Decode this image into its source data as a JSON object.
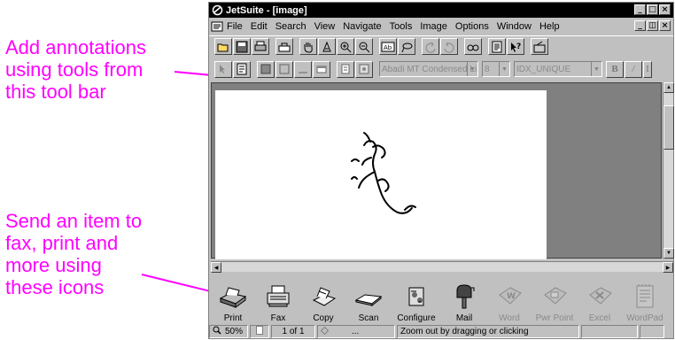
{
  "callouts": {
    "toolbar_note": [
      "Add annotations",
      "using tools from",
      "this tool bar"
    ],
    "icons_note": [
      "Send an item to",
      "fax, print and",
      "more using",
      "these icons"
    ]
  },
  "window": {
    "title": "JetSuite - [image]",
    "menu": [
      {
        "label": "File"
      },
      {
        "label": "Edit"
      },
      {
        "label": "Search"
      },
      {
        "label": "View"
      },
      {
        "label": "Navigate"
      },
      {
        "label": "Tools"
      },
      {
        "label": "Image"
      },
      {
        "label": "Options"
      },
      {
        "label": "Window"
      },
      {
        "label": "Help"
      }
    ]
  },
  "annotation_toolbar": {
    "font_name": "Abadi MT Condensed Li",
    "font_size": "8",
    "style_name": "IDX_UNIQUE",
    "bold_label": "B",
    "italic_label": "/",
    "underline_label": "I"
  },
  "iconbar": {
    "items": [
      {
        "label": "Print",
        "enabled": true
      },
      {
        "label": "Fax",
        "enabled": true
      },
      {
        "label": "Copy",
        "enabled": true
      },
      {
        "label": "Scan",
        "enabled": true
      },
      {
        "label": "Configure",
        "enabled": true
      },
      {
        "label": "Mail",
        "enabled": true
      },
      {
        "label": "Word",
        "enabled": false
      },
      {
        "label": "Pwr Point",
        "enabled": false
      },
      {
        "label": "Excel",
        "enabled": false
      },
      {
        "label": "WordPad",
        "enabled": false
      }
    ]
  },
  "statusbar": {
    "zoom": "50%",
    "page": "1 of 1",
    "ellipsis": "...",
    "message": "Zoom out by dragging or clicking"
  },
  "colors": {
    "callout": "#ff00ff",
    "chrome": "#c0c0c0",
    "workspace": "#808080"
  }
}
